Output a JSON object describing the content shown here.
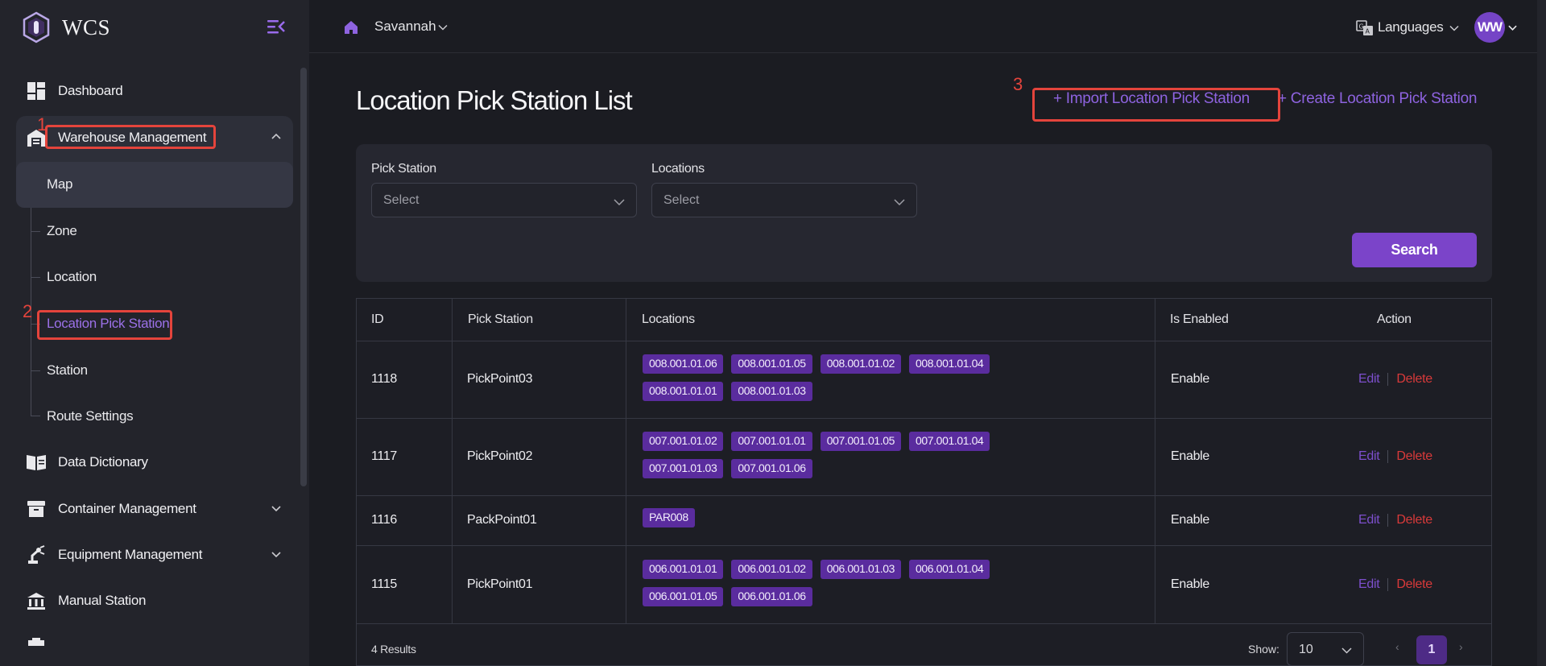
{
  "app": {
    "name": "WCS"
  },
  "topbar": {
    "workspace": "Savannah",
    "languages_label": "Languages",
    "avatar_initials": "WW"
  },
  "sidebar": {
    "dashboard": "Dashboard",
    "warehouse_management": "Warehouse Management",
    "sub_items": [
      "Map",
      "Zone",
      "Location",
      "Location Pick Station",
      "Station",
      "Route Settings"
    ],
    "data_dictionary": "Data Dictionary",
    "container_management": "Container Management",
    "equipment_management": "Equipment Management",
    "manual_station": "Manual Station"
  },
  "page": {
    "title": "Location Pick Station List",
    "import_button": "+ Import Location Pick Station",
    "create_button": "+ Create Location Pick Station"
  },
  "filters": {
    "pick_station_label": "Pick Station",
    "pick_station_placeholder": "Select",
    "locations_label": "Locations",
    "locations_placeholder": "Select",
    "search_button": "Search"
  },
  "table": {
    "headers": {
      "id": "ID",
      "pick_station": "Pick Station",
      "locations": "Locations",
      "is_enabled": "Is Enabled",
      "action": "Action"
    },
    "rows": [
      {
        "id": "1118",
        "pick_station": "PickPoint03",
        "locations": [
          "008.001.01.06",
          "008.001.01.05",
          "008.001.01.02",
          "008.001.01.04",
          "008.001.01.01",
          "008.001.01.03"
        ],
        "is_enabled": "Enable",
        "edit": "Edit",
        "delete": "Delete"
      },
      {
        "id": "1117",
        "pick_station": "PickPoint02",
        "locations": [
          "007.001.01.02",
          "007.001.01.01",
          "007.001.01.05",
          "007.001.01.04",
          "007.001.01.03",
          "007.001.01.06"
        ],
        "is_enabled": "Enable",
        "edit": "Edit",
        "delete": "Delete"
      },
      {
        "id": "1116",
        "pick_station": "PackPoint01",
        "locations": [
          "PAR008"
        ],
        "is_enabled": "Enable",
        "edit": "Edit",
        "delete": "Delete"
      },
      {
        "id": "1115",
        "pick_station": "PickPoint01",
        "locations": [
          "006.001.01.01",
          "006.001.01.02",
          "006.001.01.03",
          "006.001.01.04",
          "006.001.01.05",
          "006.001.01.06"
        ],
        "is_enabled": "Enable",
        "edit": "Edit",
        "delete": "Delete"
      }
    ],
    "results_text": "4 Results",
    "show_label": "Show:",
    "page_size": "10",
    "current_page": "1"
  },
  "annotations": [
    "1",
    "2",
    "3"
  ],
  "colors": {
    "accent": "#7b44c9",
    "link": "#8e63e0",
    "danger": "#d93a3a",
    "annotation": "#e4443c",
    "tag": "#5a2c9e"
  }
}
